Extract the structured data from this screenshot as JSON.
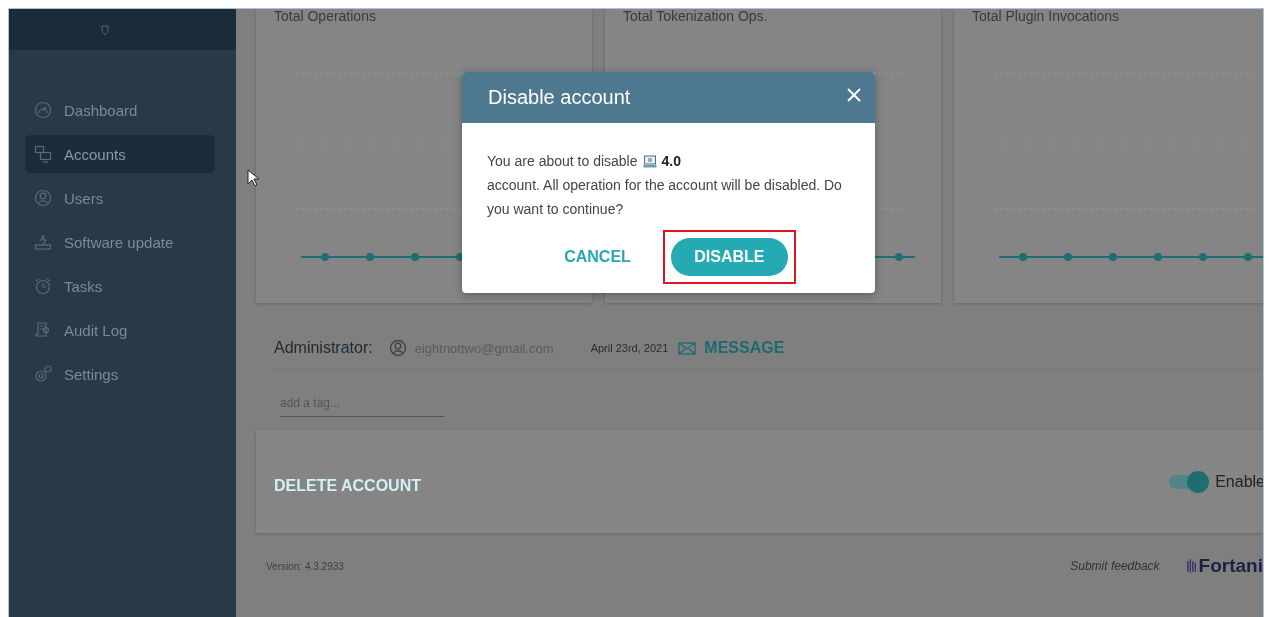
{
  "sidebar": {
    "items": [
      {
        "label": "Dashboard",
        "selected": false
      },
      {
        "label": "Accounts",
        "selected": true
      },
      {
        "label": "Users",
        "selected": false
      },
      {
        "label": "Software update",
        "selected": false
      },
      {
        "label": "Tasks",
        "selected": false
      },
      {
        "label": "Audit Log",
        "selected": false
      },
      {
        "label": "Settings",
        "selected": false
      }
    ]
  },
  "charts": [
    {
      "title": "Total Operations"
    },
    {
      "title": "Total Tokenization Ops."
    },
    {
      "title": "Total Plugin Invocations"
    }
  ],
  "admin": {
    "label": "Administrator:",
    "email": "eightnottwo@gmail.com",
    "date": "April 23rd, 2021",
    "message_button": "MESSAGE"
  },
  "tag_field": {
    "placeholder": "add a tag..."
  },
  "delete_button": "DELETE ACCOUNT",
  "status_toggle": {
    "on": true,
    "label": "Enable"
  },
  "footer": {
    "version": "Version: 4.3.2933",
    "feedback": "Submit feedback",
    "logo": "Fortani"
  },
  "modal": {
    "title": "Disable account",
    "text_before": "You are about to disable",
    "account": "4.0",
    "text_after": "account. All operation for the account will be disabled. Do you want to continue?",
    "buttons": [
      {
        "label": "CANCEL",
        "kind": "text",
        "highlighted": false
      },
      {
        "label": "DISABLE",
        "kind": "primary",
        "highlighted": true
      }
    ]
  }
}
